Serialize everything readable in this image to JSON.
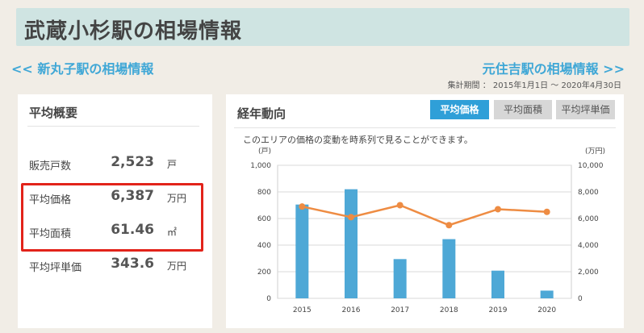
{
  "header": {
    "title": "武蔵小杉駅の相場情報"
  },
  "nav": {
    "prev_label": "<< 新丸子駅の相場情報",
    "next_label": "元住吉駅の相場情報 >>",
    "period": "集計期間 ： 2015年1月1日 〜 2020年4月30日"
  },
  "summary": {
    "title": "平均概要",
    "rows": [
      {
        "label": "販売戸数",
        "value": "2,523",
        "unit": "戸"
      },
      {
        "label": "平均価格",
        "value": "6,387",
        "unit": "万円"
      },
      {
        "label": "平均面積",
        "value": "61.46",
        "unit": "㎡"
      },
      {
        "label": "平均坪単価",
        "value": "343.6",
        "unit": "万円"
      }
    ]
  },
  "trend": {
    "title": "経年動向",
    "tabs": [
      "平均価格",
      "平均面積",
      "平均坪単価"
    ],
    "active_tab": 0,
    "description": "このエリアの価格の変動を時系列で見ることができます。"
  },
  "colors": {
    "bar": "#4ea8d6",
    "line": "#ee8c43",
    "tab_active": "#2f9fd8",
    "highlight": "#e2231a"
  },
  "chart_data": {
    "type": "bar",
    "categories": [
      "2015",
      "2016",
      "2017",
      "2018",
      "2019",
      "2020"
    ],
    "series": [
      {
        "type": "bar",
        "axis": "left",
        "values": [
          705,
          820,
          295,
          445,
          208,
          58
        ]
      },
      {
        "type": "line",
        "axis": "right",
        "values": [
          6900,
          6100,
          7000,
          5500,
          6700,
          6500
        ]
      }
    ],
    "y_left": {
      "unit": "(戸)",
      "ylim": [
        0,
        1000
      ],
      "ticks": [
        "0",
        "200",
        "400",
        "600",
        "800",
        "1,000"
      ]
    },
    "y_right": {
      "unit": "(万円)",
      "ylim": [
        0,
        10000
      ],
      "ticks": [
        "0",
        "2,000",
        "4,000",
        "6,000",
        "8,000",
        "10,000"
      ]
    },
    "grid": true
  }
}
